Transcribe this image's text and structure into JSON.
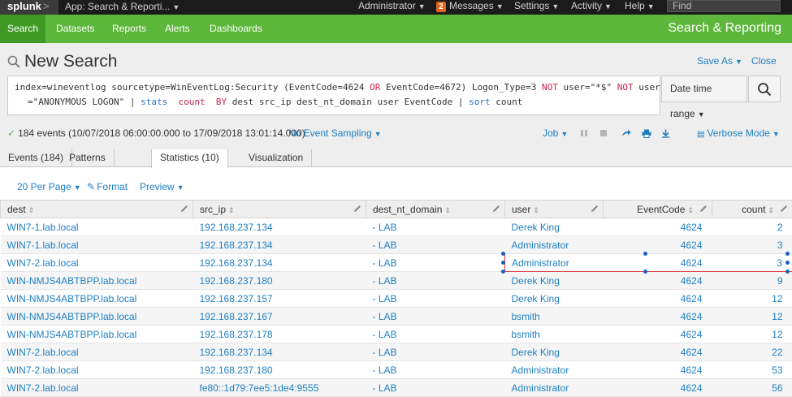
{
  "topbar": {
    "logo": "splunk",
    "logo_suffix": ">",
    "app_menu": "App: Search & Reporti...",
    "user_menu": "Administrator",
    "messages_count": "2",
    "messages_label": "Messages",
    "settings": "Settings",
    "activity": "Activity",
    "help": "Help",
    "find_placeholder": "Find"
  },
  "appbar": {
    "nav": [
      "Search",
      "Datasets",
      "Reports",
      "Alerts",
      "Dashboards"
    ],
    "active": "Search",
    "app_title": "Search & Reporting"
  },
  "search": {
    "page_title": "New Search",
    "save_as": "Save As",
    "close": "Close",
    "time_range": "Date time range",
    "query_line1": [
      {
        "t": "index=wineventlog sourcetype=WinEventLog:Security (EventCode=4624 ",
        "c": ""
      },
      {
        "t": "OR",
        "c": "kw"
      },
      {
        "t": " EventCode=4672) Logon_Type=3 ",
        "c": ""
      },
      {
        "t": "NOT",
        "c": "kw"
      },
      {
        "t": " user=\"*$\" ",
        "c": ""
      },
      {
        "t": "NOT",
        "c": "kw"
      },
      {
        "t": " user",
        "c": ""
      }
    ],
    "query_line2": [
      {
        "t": "=\"ANONYMOUS LOGON\" | ",
        "c": ""
      },
      {
        "t": "stats",
        "c": "cmd"
      },
      {
        "t": "  ",
        "c": ""
      },
      {
        "t": "count",
        "c": "fn"
      },
      {
        "t": "  ",
        "c": ""
      },
      {
        "t": "BY",
        "c": "kw"
      },
      {
        "t": " dest src_ip dest_nt_domain user EventCode | ",
        "c": ""
      },
      {
        "t": "sort",
        "c": "cmd"
      },
      {
        "t": " count",
        "c": ""
      }
    ],
    "status": "184 events (10/07/2018 06:00:00.000 to 17/09/2018 13:01:14.000)",
    "sampling": "No Event Sampling",
    "job": "Job",
    "mode": "Verbose Mode"
  },
  "tabs": [
    "Events (184)",
    "Patterns",
    "Statistics (10)",
    "Visualization"
  ],
  "active_tab": "Statistics (10)",
  "results_toolbar": {
    "per_page": "20 Per Page",
    "format": "Format",
    "preview": "Preview"
  },
  "table": {
    "columns": [
      "dest",
      "src_ip",
      "dest_nt_domain",
      "user",
      "EventCode",
      "count"
    ],
    "rows": [
      [
        "WIN7-1.lab.local",
        "192.168.237.134",
        "- LAB",
        "Derek King",
        "4624",
        "2"
      ],
      [
        "WIN7-1.lab.local",
        "192.168.237.134",
        "- LAB",
        "Administrator",
        "4624",
        "3"
      ],
      [
        "WIN7-2.lab.local",
        "192.168.237.134",
        "- LAB",
        "Administrator",
        "4624",
        "3"
      ],
      [
        "WIN-NMJS4ABTBPP.lab.local",
        "192.168.237.180",
        "- LAB",
        "Derek King",
        "4624",
        "9"
      ],
      [
        "WIN-NMJS4ABTBPP.lab.local",
        "192.168.237.157",
        "- LAB",
        "Derek King",
        "4624",
        "12"
      ],
      [
        "WIN-NMJS4ABTBPP.lab.local",
        "192.168.237.167",
        "- LAB",
        "bsmith",
        "4624",
        "12"
      ],
      [
        "WIN-NMJS4ABTBPP.lab.local",
        "192.168.237.178",
        "- LAB",
        "bsmith",
        "4624",
        "12"
      ],
      [
        "WIN7-2.lab.local",
        "192.168.237.134",
        "- LAB",
        "Derek King",
        "4624",
        "22"
      ],
      [
        "WIN7-2.lab.local",
        "192.168.237.180",
        "- LAB",
        "Administrator",
        "4624",
        "53"
      ],
      [
        "WIN7-2.lab.local",
        "fe80::1d79:7ee5:1de4:9555",
        "- LAB",
        "Administrator",
        "4624",
        "56"
      ]
    ],
    "selected_row": 2
  },
  "colors": {
    "topbar": "#1b1b1b",
    "appbar": "#5cb73a",
    "link": "#1e7fc2",
    "selection": "#d93f3c"
  }
}
